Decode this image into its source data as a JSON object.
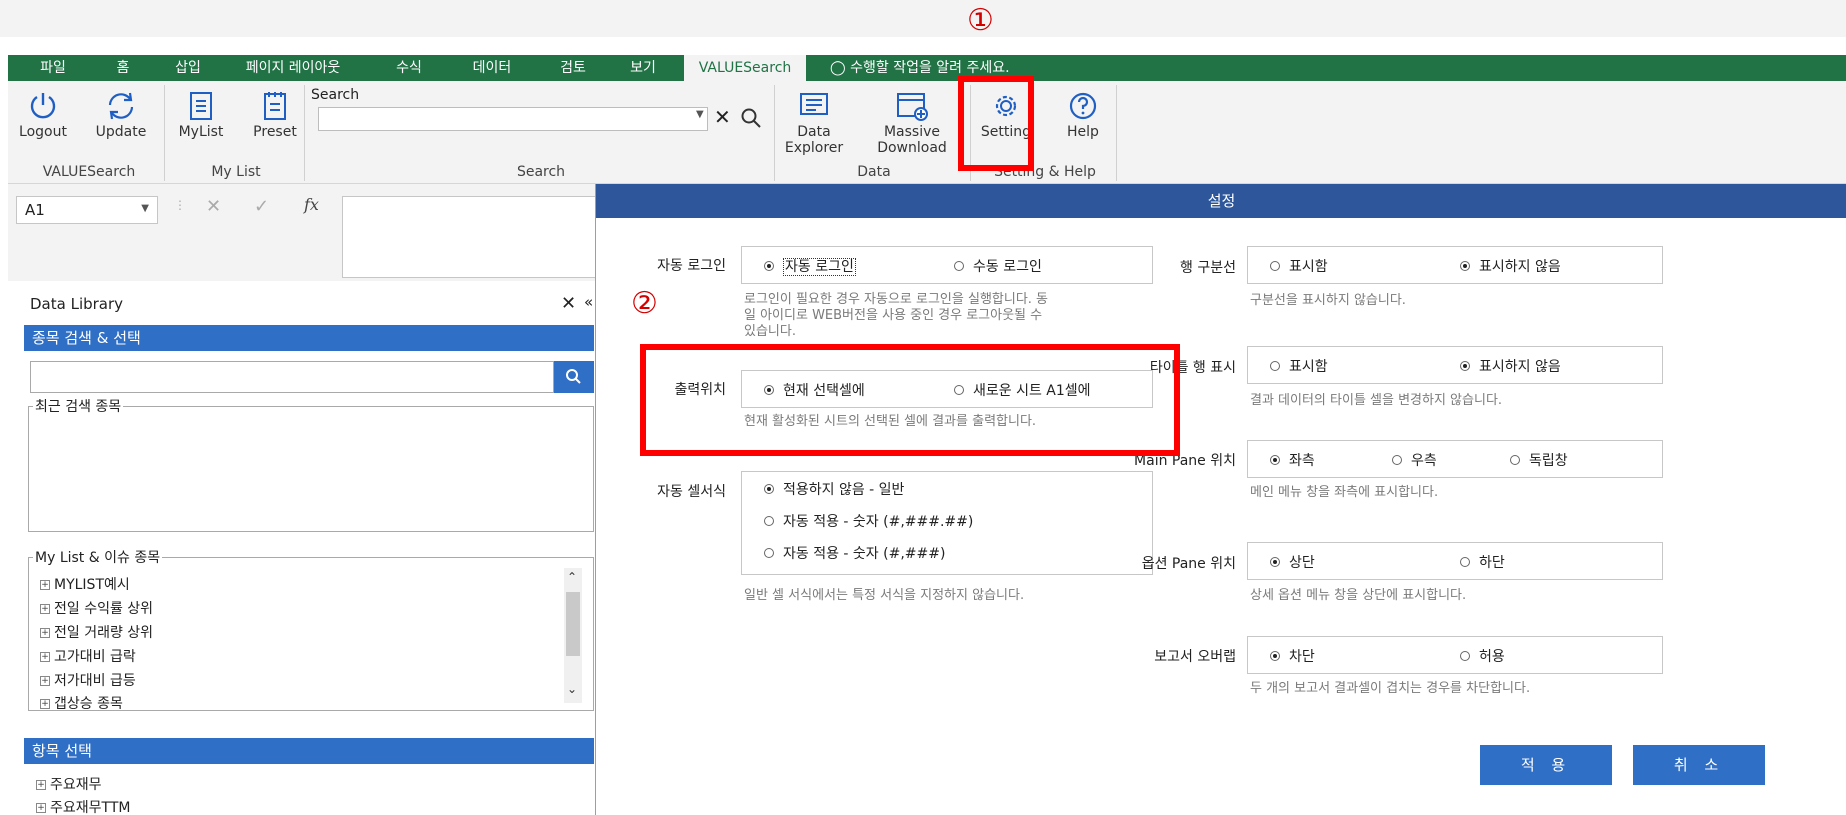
{
  "annotations": {
    "marker_1": "①",
    "marker_2": "②"
  },
  "ribbon_tabs": [
    "파일",
    "홈",
    "삽입",
    "페이지 레이아웃",
    "수식",
    "데이터",
    "검토",
    "보기",
    "VALUESearch"
  ],
  "tell_me": "수행할 작업을 알려 주세요.",
  "ribbon": {
    "logout": "Logout",
    "update": "Update",
    "mylist": "MyList",
    "preset": "Preset",
    "search_label": "Search",
    "data_explorer_1": "Data",
    "data_explorer_2": "Explorer",
    "massive_download_1": "Massive",
    "massive_download_2": "Download",
    "setting": "Setting",
    "help": "Help",
    "groups": {
      "valuesearch": "VALUESearch",
      "mylist": "My List",
      "search": "Search",
      "data": "Data",
      "setting_help": "Setting & Help"
    }
  },
  "formula_bar": {
    "name_box": "A1",
    "fx": "fx"
  },
  "library": {
    "title": "Data Library",
    "stock_section": "종목 검색 & 선택",
    "recent_legend": "최근 검색 종목",
    "mylist_legend": "My List & 이슈 종목",
    "mylist_items": [
      "MYLIST예시",
      "전일 수익률 상위",
      "전일 거래량 상위",
      "고가대비 급락",
      "저가대비 급등",
      "갭상승 종목"
    ],
    "field_section": "항목 선택",
    "field_items": [
      "주요재무",
      "주요재무TTM"
    ]
  },
  "dialog": {
    "title": "설정",
    "auto_login": {
      "label": "자동 로그인",
      "opt1": "자동 로그인",
      "opt2": "수동 로그인",
      "desc1": "로그인이 필요한 경우 자동으로 로그인을 실행합니다. 동",
      "desc2": "일 아이디로 WEB버전을 사용 중인 경우 로그아웃될 수",
      "desc3": "있습니다."
    },
    "output_position": {
      "label": "출력위치",
      "opt1": "현재 선택셀에",
      "opt2": "새로운 시트 A1셀에",
      "desc": "현재 활성화된 시트의 선택된 셀에 결과를 출력합니다."
    },
    "auto_format": {
      "label": "자동 셀서식",
      "opt1": "적용하지 않음 - 일반",
      "opt2": "자동 적용 - 숫자 (#,###.##)",
      "opt3": "자동 적용 - 숫자 (#,###)",
      "desc": "일반 셀 서식에서는 특정 서식을 지정하지 않습니다."
    },
    "row_divider": {
      "label": "행 구분선",
      "opt1": "표시함",
      "opt2": "표시하지 않음",
      "desc": "구분선을 표시하지 않습니다."
    },
    "title_row": {
      "label": "타이틀 행 표시",
      "opt1": "표시함",
      "opt2": "표시하지 않음",
      "desc": "결과 데이터의 타이틀 셀을 변경하지 않습니다."
    },
    "main_pane": {
      "label": "Main Pane 위치",
      "opt1": "좌측",
      "opt2": "우측",
      "opt3": "독립창",
      "desc": "메인 메뉴 창을 좌측에 표시합니다."
    },
    "option_pane": {
      "label": "옵션 Pane 위치",
      "opt1": "상단",
      "opt2": "하단",
      "desc": "상세 옵션 메뉴 창을 상단에 표시합니다."
    },
    "report_overlap": {
      "label": "보고서 오버랩",
      "opt1": "차단",
      "opt2": "허용",
      "desc": "두 개의 보고서 결과셀이 겹치는 경우를 차단합니다."
    },
    "apply": "적 용",
    "cancel": "취 소"
  }
}
